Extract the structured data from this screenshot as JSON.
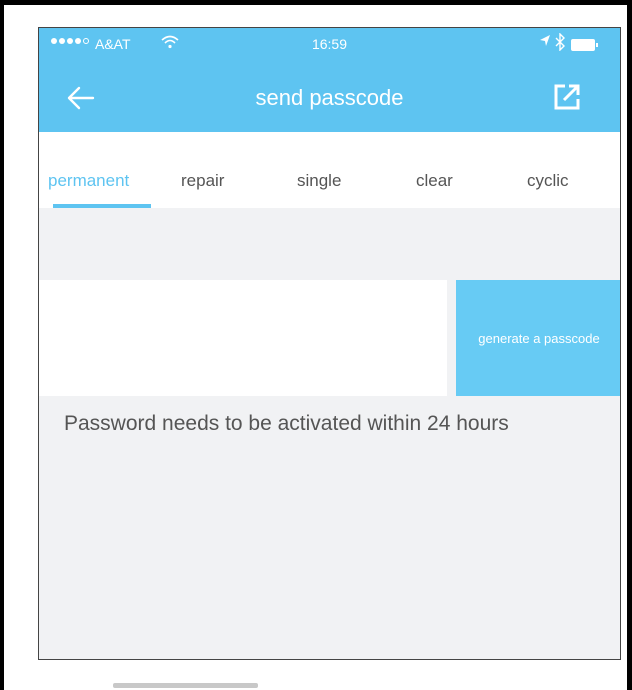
{
  "status_bar": {
    "carrier": "A&AT",
    "time": "16:59",
    "signal_bars_filled": 4,
    "signal_bars_total": 5
  },
  "header": {
    "title": "send passcode",
    "back_icon": "arrow-left-icon",
    "share_icon": "share-icon"
  },
  "tabs": [
    {
      "label": "permanent",
      "active": true
    },
    {
      "label": "repair",
      "active": false
    },
    {
      "label": "single",
      "active": false
    },
    {
      "label": "clear",
      "active": false
    },
    {
      "label": "cyclic",
      "active": false
    }
  ],
  "passcode_input": {
    "value": "",
    "placeholder": ""
  },
  "generate_button": {
    "label": "generate a passcode"
  },
  "notice": "Password needs to be activated within 24 hours",
  "colors": {
    "accent": "#5ec4f1",
    "background": "#f1f2f4",
    "text": "#555555"
  }
}
